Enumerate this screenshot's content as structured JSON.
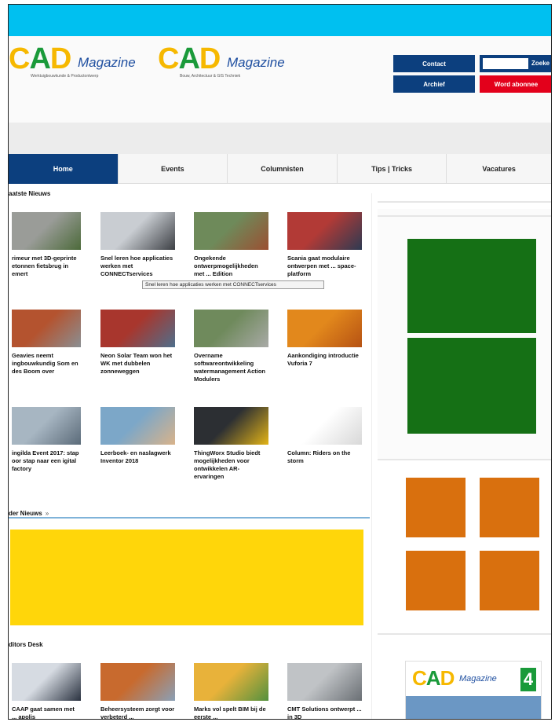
{
  "header": {
    "logo1": {
      "cad": "CAD",
      "magazine": "Magazine",
      "tagline": "Werktuigbouwkunde & Productontwerp"
    },
    "logo2": {
      "cad": "CAD",
      "magazine": "Magazine",
      "tagline": "Bouw, Architectuur & GIS Techniek"
    },
    "contact_label": "Contact",
    "archief_label": "Archief",
    "search_label": "Zoeke",
    "search_value": "",
    "abonnee_label": "Word abonnee"
  },
  "nav": {
    "items": [
      {
        "label": "Home",
        "active": true
      },
      {
        "label": "Events",
        "active": false
      },
      {
        "label": "Columnisten",
        "active": false
      },
      {
        "label": "Tips | Tricks",
        "active": false
      },
      {
        "label": "Vacatures",
        "active": false
      }
    ]
  },
  "sections": {
    "latest": "aatste Nieuws",
    "more": "der Nieuws",
    "more_arrow": "»",
    "editors": "ditors Desk"
  },
  "latest_news": [
    {
      "caption": "rimeur met 3D-geprinte etonnen fietsbrug in emert",
      "colors": [
        "#9a9c98",
        "#4c6a3a"
      ]
    },
    {
      "caption": "Snel leren hoe applicaties werken met CONNECTservices",
      "colors": [
        "#c9cdd2",
        "#3c3f44"
      ]
    },
    {
      "caption": "Ongekende ontwerpmogelijkheden met ... Edition",
      "colors": [
        "#6e8a5a",
        "#9b4f32"
      ]
    },
    {
      "caption": "Scania gaat modulaire ontwerpen met ... space-platform",
      "colors": [
        "#b23a36",
        "#2d3a52"
      ]
    },
    {
      "caption": "Geavies neemt ingbouwkundig Som en des Boom over",
      "colors": [
        "#b4532f",
        "#8a8f93"
      ]
    },
    {
      "caption": "Neon Solar Team won het WK met dubbelen zonneweggen",
      "colors": [
        "#a8362d",
        "#4e6f8c"
      ]
    },
    {
      "caption": "Overname softwareontwikkeling watermanagement Action Modulers",
      "colors": [
        "#6f8a5c",
        "#a9aaa7"
      ]
    },
    {
      "caption": "Aankondiging introductie Vuforia 7",
      "colors": [
        "#e2881c",
        "#b65213"
      ]
    },
    {
      "caption": "ingilda Event 2017: stap oor stap naar een igital factory",
      "colors": [
        "#a7b6c2",
        "#5b6b79"
      ]
    },
    {
      "caption": "Leerboek- en naslagwerk Inventor 2018",
      "colors": [
        "#7ca7c8",
        "#d9b38a"
      ]
    },
    {
      "caption": "ThingWorx Studio biedt mogelijkheden voor ontwikkelen AR-ervaringen",
      "colors": [
        "#2c2f33",
        "#e3b417"
      ]
    },
    {
      "caption": "Column: Riders on the storm",
      "colors": [
        "#ffffff",
        "#d8d8d8"
      ]
    }
  ],
  "tooltip": "Snel leren hoe applicaties werken met CONNECTservices",
  "editors_desk": [
    {
      "caption": "CAAP gaat samen met ... apolis",
      "colors": [
        "#d6dbe2",
        "#2a3240"
      ]
    },
    {
      "caption": "Beheersysteem zorgt voor verbeterd ...",
      "colors": [
        "#c86a2e",
        "#8aa0b7"
      ]
    },
    {
      "caption": "Marks vol spelt BIM bij de eerste ...",
      "colors": [
        "#e8b23a",
        "#53913f"
      ]
    },
    {
      "caption": "CMT Solutions ontwerpt ... in 3D",
      "colors": [
        "#c0c3c6",
        "#6a6f74"
      ]
    }
  ],
  "sidebar": {
    "cad4": {
      "cad": "CAD",
      "magazine": "Magazine",
      "number": "4"
    },
    "green": "#157015",
    "orange": "#d9700e"
  },
  "colors": {
    "topbar": "#00c0f0",
    "nav_active": "#0c3f7e",
    "abonnee": "#e3001b",
    "banner": "#ffd60a"
  }
}
